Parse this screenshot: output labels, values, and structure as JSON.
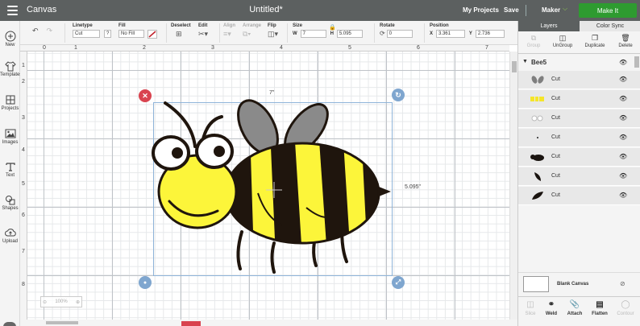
{
  "topbar": {
    "app_title": "Canvas",
    "doc_title": "Untitled*",
    "my_projects": "My Projects",
    "save": "Save",
    "machine": "Maker",
    "make_it": "Make It"
  },
  "toolbar": {
    "linetype_label": "Linetype",
    "linetype_value": "Cut",
    "linetype_help": "?",
    "fill_label": "Fill",
    "fill_value": "No Fill",
    "deselect_label": "Deselect",
    "edit_label": "Edit",
    "align_label": "Align",
    "arrange_label": "Arrange",
    "flip_label": "Flip",
    "size_label": "Size",
    "w_label": "W",
    "w_value": "7",
    "h_label": "H",
    "h_value": "5.095",
    "rotate_label": "Rotate",
    "rotate_value": "0",
    "position_label": "Position",
    "x_label": "X",
    "x_value": "3.361",
    "y_label": "Y",
    "y_value": "2.736"
  },
  "leftbar": {
    "items": [
      {
        "label": "New",
        "icon": "plus-icon"
      },
      {
        "label": "Templates",
        "icon": "shirt-icon"
      },
      {
        "label": "Projects",
        "icon": "projects-icon"
      },
      {
        "label": "Images",
        "icon": "image-icon"
      },
      {
        "label": "Text",
        "icon": "text-icon"
      },
      {
        "label": "Shapes",
        "icon": "shapes-icon"
      },
      {
        "label": "Upload",
        "icon": "upload-cloud-icon"
      }
    ]
  },
  "rulers": {
    "top": [
      "0",
      "1",
      "2",
      "3",
      "4",
      "5",
      "6",
      "7"
    ],
    "left": [
      "1",
      "2",
      "3",
      "4",
      "5",
      "6",
      "7",
      "8"
    ]
  },
  "canvas": {
    "width_label": "7\"",
    "height_label": "5.095\"",
    "zoom": "100%"
  },
  "panel": {
    "tabs": [
      "Layers",
      "Color Sync"
    ],
    "actions": {
      "group": "Group",
      "ungroup": "UnGroup",
      "duplicate": "Duplicate",
      "delete": "Delete"
    },
    "group_name": "Bee5",
    "layers": [
      {
        "op": "Cut",
        "color": "#7f7f7f"
      },
      {
        "op": "Cut",
        "color": "#f5e52a"
      },
      {
        "op": "Cut",
        "color": "#dddddd"
      },
      {
        "op": "Cut",
        "color": "#222222"
      },
      {
        "op": "Cut",
        "color": "#1a1410"
      },
      {
        "op": "Cut",
        "color": "#1a1410"
      },
      {
        "op": "Cut",
        "color": "#1a1410"
      }
    ],
    "blank_canvas": "Blank Canvas",
    "bottom_actions": {
      "slice": "Slice",
      "weld": "Weld",
      "attach": "Attach",
      "flatten": "Flatten",
      "contour": "Contour"
    }
  },
  "colors": {
    "topbar": "#5c6060",
    "make_it": "#2e9b30",
    "bee_yellow": "#fcf53a",
    "bee_dark": "#1f150d",
    "wing_gray": "#8a8a8a",
    "delete_handle": "#d9434f",
    "blue_handle": "#7fa6cf"
  }
}
